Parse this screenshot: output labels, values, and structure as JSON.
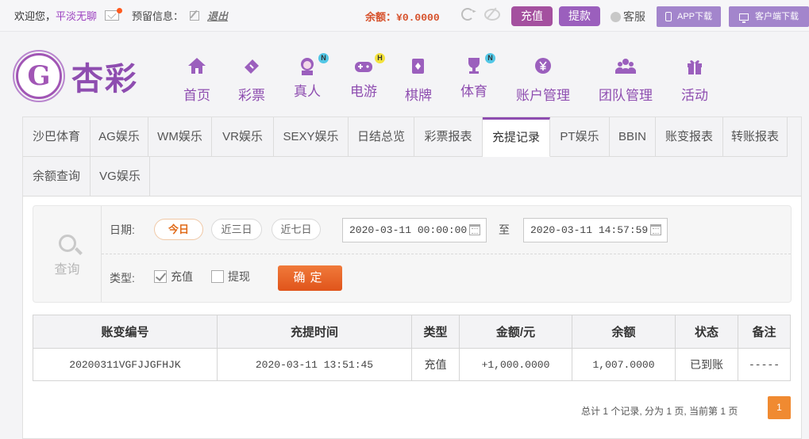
{
  "topbar": {
    "welcome": "欢迎您，",
    "username": "平淡无聊",
    "warning_label": "预留信息：",
    "logout": "退出",
    "balance_label": "余额：",
    "balance_value": "¥0.0000",
    "recharge": "充值",
    "withdraw": "提款",
    "service": "客服",
    "app_download": "APP下载",
    "client_download": "客户端下载"
  },
  "brand": {
    "logo_mark": "G",
    "logo_text": "杏彩"
  },
  "nav": [
    {
      "label": "首页",
      "icon": "home-icon"
    },
    {
      "label": "彩票",
      "icon": "lottery-ticket-icon"
    },
    {
      "label": "真人",
      "icon": "live-dealer-icon",
      "badge": "N"
    },
    {
      "label": "电游",
      "icon": "gamepad-icon",
      "badge": "H"
    },
    {
      "label": "棋牌",
      "icon": "cards-icon"
    },
    {
      "label": "体育",
      "icon": "trophy-icon",
      "badge": "N"
    },
    {
      "label": "账户管理",
      "icon": "account-yen-icon"
    },
    {
      "label": "团队管理",
      "icon": "team-icon"
    },
    {
      "label": "活动",
      "icon": "gift-icon"
    }
  ],
  "tabs": [
    "沙巴体育",
    "AG娱乐",
    "WM娱乐",
    "VR娱乐",
    "SEXY娱乐",
    "日结总览",
    "彩票报表",
    "充提记录",
    "PT娱乐",
    "BBIN",
    "账变报表",
    "转账报表",
    "余额查询",
    "VG娱乐"
  ],
  "active_tab": "充提记录",
  "query": {
    "side_label": "查询",
    "date_label": "日期:",
    "quick_ranges": [
      "今日",
      "近三日",
      "近七日"
    ],
    "active_range": "今日",
    "start_date": "2020-03-11 00:00:00",
    "to_label": "至",
    "end_date": "2020-03-11 14:57:59",
    "type_label": "类型:",
    "type_options": [
      {
        "label": "充值",
        "checked": true
      },
      {
        "label": "提现",
        "checked": false
      }
    ],
    "confirm": "确定"
  },
  "table": {
    "headers": [
      "账变编号",
      "充提时间",
      "类型",
      "金额/元",
      "余额",
      "状态",
      "备注"
    ],
    "rows": [
      [
        "20200311VGFJJGFHJK",
        "2020-03-11 13:51:45",
        "充值",
        "+1,000.0000",
        "1,007.0000",
        "已到账",
        "-----"
      ]
    ]
  },
  "pagination": {
    "summary": "总计 1 个记录, 分为 1 页, 当前第 1 页",
    "current_page": "1"
  },
  "colors": {
    "brand_purple": "#8e4db0",
    "balance_orange": "#d6502a",
    "confirm_orange": "#e0541b",
    "status_green": "#2e9a2e",
    "amount_red": "#c11919"
  }
}
